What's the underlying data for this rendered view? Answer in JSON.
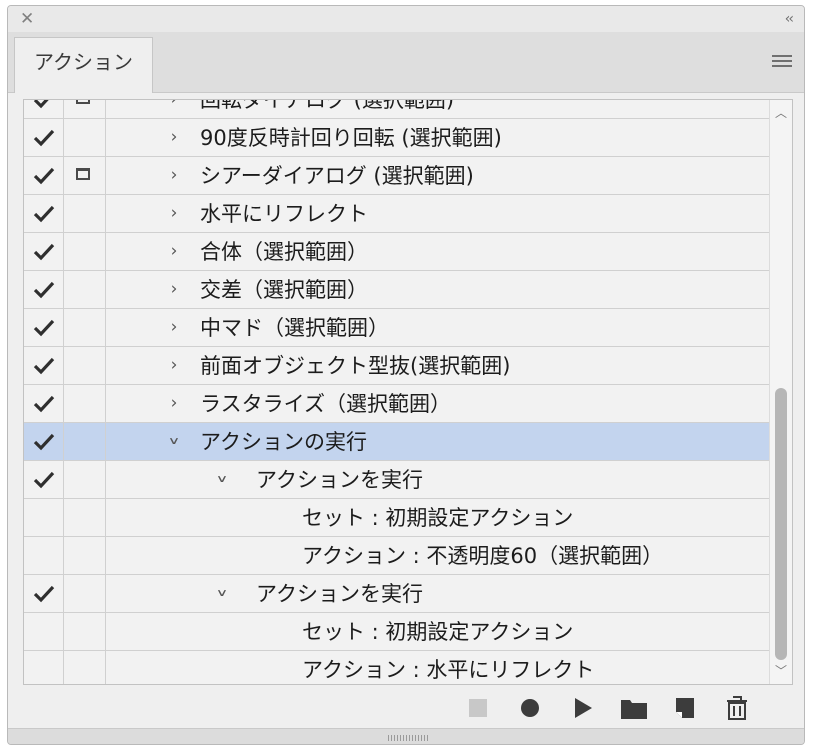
{
  "tab": {
    "label": "アクション"
  },
  "header_icons": {
    "close": "close-icon",
    "collapse": "collapse-icon",
    "menu": "panel-menu-icon"
  },
  "rows": [
    {
      "check": true,
      "dialog": true,
      "expanded": false,
      "indent": 0,
      "label": "回転ダイアログ (選択範囲)",
      "selected": false
    },
    {
      "check": true,
      "dialog": false,
      "expanded": false,
      "indent": 0,
      "label": "90度反時計回り回転 (選択範囲)",
      "selected": false
    },
    {
      "check": true,
      "dialog": true,
      "expanded": false,
      "indent": 0,
      "label": "シアーダイアログ (選択範囲)",
      "selected": false
    },
    {
      "check": true,
      "dialog": false,
      "expanded": false,
      "indent": 0,
      "label": "水平にリフレクト",
      "selected": false
    },
    {
      "check": true,
      "dialog": false,
      "expanded": false,
      "indent": 0,
      "label": "合体（選択範囲）",
      "selected": false
    },
    {
      "check": true,
      "dialog": false,
      "expanded": false,
      "indent": 0,
      "label": "交差（選択範囲）",
      "selected": false
    },
    {
      "check": true,
      "dialog": false,
      "expanded": false,
      "indent": 0,
      "label": "中マド（選択範囲）",
      "selected": false
    },
    {
      "check": true,
      "dialog": false,
      "expanded": false,
      "indent": 0,
      "label": "前面オブジェクト型抜(選択範囲)",
      "selected": false
    },
    {
      "check": true,
      "dialog": false,
      "expanded": false,
      "indent": 0,
      "label": "ラスタライズ（選択範囲）",
      "selected": false
    },
    {
      "check": true,
      "dialog": false,
      "expanded": true,
      "indent": 0,
      "label": "アクションの実行",
      "selected": true
    },
    {
      "check": true,
      "dialog": false,
      "expanded": true,
      "indent": 1,
      "label": "アクションを実行",
      "selected": false
    },
    {
      "check": false,
      "dialog": false,
      "expanded": null,
      "indent": 2,
      "label": "セット : 初期設定アクション",
      "selected": false
    },
    {
      "check": false,
      "dialog": false,
      "expanded": null,
      "indent": 2,
      "label": "アクション : 不透明度60（選択範囲）",
      "selected": false
    },
    {
      "check": true,
      "dialog": false,
      "expanded": true,
      "indent": 1,
      "label": "アクションを実行",
      "selected": false
    },
    {
      "check": false,
      "dialog": false,
      "expanded": null,
      "indent": 2,
      "label": "セット : 初期設定アクション",
      "selected": false
    },
    {
      "check": false,
      "dialog": false,
      "expanded": null,
      "indent": 2,
      "label": "アクション : 水平にリフレクト",
      "selected": false
    }
  ],
  "toolbar": {
    "buttons": [
      "stop-icon",
      "record-icon",
      "play-icon",
      "new-set-folder-icon",
      "new-action-icon",
      "trash-icon"
    ],
    "stop_disabled": true
  },
  "colors": {
    "selected_row": "#c3d4ee",
    "panel_bg": "#efefef",
    "row_bg": "#f2f2f2"
  }
}
